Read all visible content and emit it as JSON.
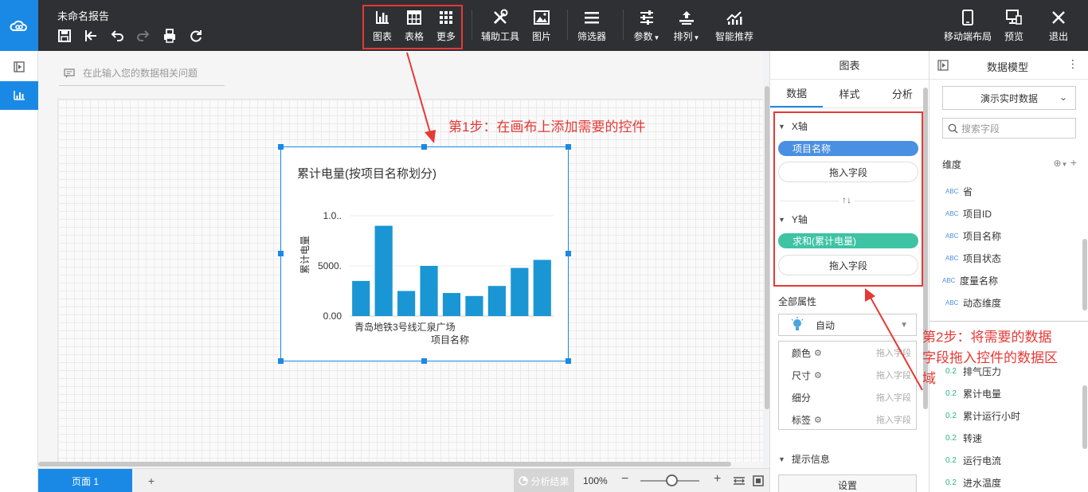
{
  "header": {
    "title": "未命名报告",
    "file_tools": [
      "save-icon",
      "exit-edit-icon",
      "undo-icon",
      "redo-icon",
      "print-icon",
      "refresh-icon"
    ],
    "insert": [
      {
        "label": "图表",
        "icon": "bar-chart-icon"
      },
      {
        "label": "表格",
        "icon": "table-icon"
      },
      {
        "label": "更多",
        "icon": "grid-icon"
      }
    ],
    "tools": [
      {
        "label": "辅助工具",
        "icon": "tools-icon"
      },
      {
        "label": "图片",
        "icon": "image-icon"
      },
      {
        "label": "筛选器",
        "icon": "filter-icon"
      },
      {
        "label": "参数",
        "icon": "sliders-icon"
      },
      {
        "label": "排列",
        "icon": "arrange-icon"
      },
      {
        "label": "智能推荐",
        "icon": "smart-chart-icon"
      }
    ],
    "right": [
      {
        "label": "移动端布局",
        "icon": "mobile-icon"
      },
      {
        "label": "预览",
        "icon": "preview-icon"
      },
      {
        "label": "退出",
        "icon": "close-icon"
      }
    ]
  },
  "workspace": {
    "question_placeholder": "在此输入您的数据相关问题"
  },
  "widget": {
    "title": "累计电量(按项目名称划分)",
    "x_tick": "青岛地铁3号线汇泉广场",
    "chart_data": {
      "type": "bar",
      "title": "累计电量(按项目名称划分)",
      "xlabel": "项目名称",
      "ylabel": "累计电量",
      "categories": [
        "青岛地铁3号线汇泉广场",
        "",
        "",
        "",
        "",
        "",
        "",
        "",
        "",
        ""
      ],
      "values": [
        3500,
        9000,
        2500,
        5000,
        2300,
        2000,
        3000,
        4800,
        5600
      ],
      "y_ticks": [
        "0.00",
        "5000.",
        "1.0.."
      ],
      "ylim": [
        0,
        10000
      ],
      "grid": true,
      "color": "#1a96d4"
    }
  },
  "annotations": {
    "step1": "第1步：在画布上添加需要的控件",
    "step2_lines": [
      "第2步：将需要的数据",
      "字段拖入控件的数据区",
      "域"
    ]
  },
  "bottombar": {
    "page_tab": "页面 1",
    "add": "+",
    "analysis": "分析结果",
    "zoom": "100%",
    "minus": "−",
    "plus": "+"
  },
  "props": {
    "header": "图表",
    "tabs": [
      "数据",
      "样式",
      "分析"
    ],
    "x_axis": {
      "label": "X轴",
      "field": "项目名称",
      "drop": "拖入字段"
    },
    "swap": "↑↓",
    "y_axis": {
      "label": "Y轴",
      "field": "求和(累计电量)",
      "drop": "拖入字段"
    },
    "all_props": "全部属性",
    "auto": "自动",
    "rows": [
      {
        "name": "颜色",
        "drop": "拖入字段",
        "gear": true
      },
      {
        "name": "尺寸",
        "drop": "拖入字段",
        "gear": true
      },
      {
        "name": "细分",
        "drop": "拖入字段",
        "gear": false
      },
      {
        "name": "标签",
        "drop": "拖入字段",
        "gear": true
      }
    ],
    "tooltip": "提示信息",
    "setting": "设置",
    "colors": {
      "x_pill": "#4a90e2",
      "y_pill": "#3ec3a4"
    }
  },
  "model": {
    "title": "数据模型",
    "dataset": "演示实时数据",
    "search_placeholder": "搜索字段",
    "dimension_header": "维度",
    "dimensions": [
      {
        "type": "ABC",
        "name": "省"
      },
      {
        "type": "ABC",
        "name": "项目ID"
      },
      {
        "type": "ABC",
        "name": "项目名称"
      },
      {
        "type": "ABC",
        "name": "项目状态"
      },
      {
        "type": "ABC",
        "name": "度量名称"
      },
      {
        "type": "ABC",
        "name": "动态维度"
      }
    ],
    "measures": [
      {
        "type": "0.2",
        "name": "排气压力"
      },
      {
        "type": "0.2",
        "name": "累计电量"
      },
      {
        "type": "0.2",
        "name": "累计运行小时"
      },
      {
        "type": "0.2",
        "name": "转速"
      },
      {
        "type": "0.2",
        "name": "运行电流"
      },
      {
        "type": "0.2",
        "name": "进水温度"
      }
    ]
  }
}
